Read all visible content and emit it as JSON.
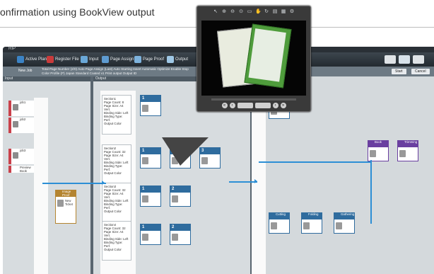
{
  "caption": "onfirmation using BookView output",
  "window": {
    "title": "RIP",
    "menu": [
      "Active Plan",
      "Register File",
      "Input",
      "Page Assign",
      "Page Proof",
      "Output"
    ],
    "new_job": "New Job",
    "info_line1": "Total Page Number (2/0)  Auto Page Assign (Last)  Auto Starting Insert  Automatic Optimize Enable  Stop",
    "info_line2": "Color Profile (P) Japan Standard Coated v1  Print output Output ID",
    "buttons": [
      "Start",
      "Cancel"
    ],
    "input_panel": "Input",
    "output_panel": "Output",
    "jobs": [
      "job1",
      "job2",
      "job3",
      "Preview Book"
    ],
    "sections": [
      {
        "title": "Section1",
        "lines": [
          "Page Count: 8",
          "Page Size: A4 Vert.",
          "Binding Side: Left",
          "Binding Type: Perf.",
          "Output Color"
        ]
      },
      {
        "title": "Section2",
        "lines": [
          "Page Count: 32",
          "Page Size: A4 Vert.",
          "Binding Side: Left",
          "Binding Type: Perf.",
          "Output Color"
        ]
      },
      {
        "title": "Section3",
        "lines": [
          "Page Count: 32",
          "Page Size: A4 Vert.",
          "Binding Side: Left",
          "Binding Type: Perf.",
          "Output Color"
        ]
      },
      {
        "title": "Section4",
        "lines": [
          "Page Count: 32",
          "Page Size: A4 Vert.",
          "Binding Side: Left",
          "Binding Type: Perf.",
          "Output Color"
        ]
      }
    ],
    "proof_node": {
      "header": "Image Proof",
      "body": "New Ticket"
    },
    "finishing": [
      "Cutting",
      "Folding",
      "Gathering",
      "Book",
      "Trimming"
    ]
  }
}
